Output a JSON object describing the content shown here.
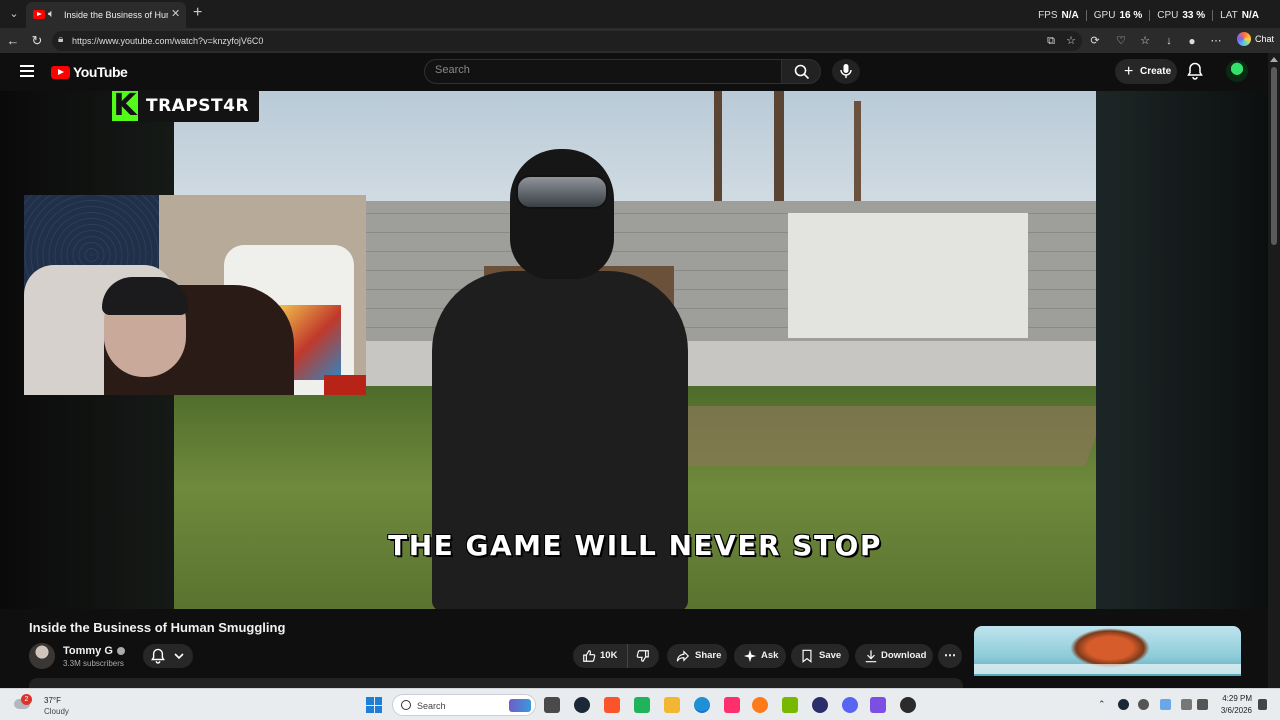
{
  "browser": {
    "tab_title": "Inside the Business of Human Smuggling",
    "url": "https://www.youtube.com/watch?v=knzyfojV6C0",
    "chat_label": "Chat",
    "perf": [
      {
        "label": "FPS",
        "value": "N/A"
      },
      {
        "label": "GPU",
        "value": "16 %"
      },
      {
        "label": "CPU",
        "value": "33 %"
      },
      {
        "label": "LAT",
        "value": "N/A"
      }
    ]
  },
  "youtube": {
    "logo_text": "YouTube",
    "search_placeholder": "Search",
    "create_label": "Create",
    "accent": "#ff0000"
  },
  "video": {
    "caption": "THE GAME WILL NEVER STOP",
    "streamer_name": "TRAPST4R",
    "kick_color": "#53fc18"
  },
  "meta": {
    "title": "Inside the Business of Human Smuggling",
    "channel": "Tommy G",
    "subscribers": "3.3M subscribers",
    "actions": {
      "like_count": "10K",
      "share": "Share",
      "ask": "Ask",
      "save": "Save",
      "download": "Download"
    }
  },
  "taskbar": {
    "weather_badge": "2",
    "temperature": "37°F",
    "condition": "Cloudy",
    "search_label": "Search",
    "time": "4:29 PM",
    "date": "3/6/2026"
  }
}
